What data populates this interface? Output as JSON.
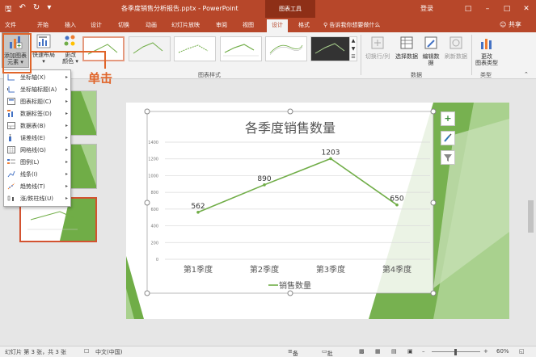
{
  "titlebar": {
    "doc_title": "各季度销售分析报告.pptx - PowerPoint",
    "context_tab": "图表工具",
    "login": "登录",
    "undo_icon": "undo-icon",
    "redo_icon": "redo-icon"
  },
  "tabs": [
    {
      "label": "文件"
    },
    {
      "label": "开始"
    },
    {
      "label": "插入"
    },
    {
      "label": "设计"
    },
    {
      "label": "切换"
    },
    {
      "label": "动画"
    },
    {
      "label": "幻灯片放映"
    },
    {
      "label": "审阅"
    },
    {
      "label": "视图"
    },
    {
      "label": "设计"
    },
    {
      "label": "格式"
    }
  ],
  "tell_me": "告诉我你想要做什么",
  "share": "共享",
  "ribbon": {
    "add_element_line1": "添加图表",
    "add_element_line2": "元素",
    "quick_layout_line1": "快速布局",
    "change_color_line1": "更改",
    "change_color_line2": "颜色",
    "chart_styles_group": "图表样式",
    "switch_row_col": "切换行/列",
    "select_data": "选择数据",
    "edit_data_line1": "编辑数",
    "edit_data_line2": "据",
    "refresh_data": "刷新数据",
    "data_group": "数据",
    "change_type_line1": "更改",
    "change_type_line2": "图表类型",
    "type_group": "类型"
  },
  "dropdown": [
    {
      "label": "坐标轴(X)"
    },
    {
      "label": "坐标轴标题(A)"
    },
    {
      "label": "图表标题(C)"
    },
    {
      "label": "数据标签(D)"
    },
    {
      "label": "数据表(B)"
    },
    {
      "label": "误差线(E)"
    },
    {
      "label": "网格线(G)"
    },
    {
      "label": "图例(L)"
    },
    {
      "label": "线条(I)"
    },
    {
      "label": "趋势线(T)"
    },
    {
      "label": "涨/跌柱线(U)"
    }
  ],
  "annotation": {
    "text": "单击"
  },
  "chart_tools": {
    "plus": "+",
    "brush_icon": "brush-icon",
    "filter_icon": "filter-icon"
  },
  "statusbar": {
    "slide_info": "幻灯片 第 3 张，共 3 张",
    "language": "中文(中国)",
    "notes": "备注",
    "comments": "批注",
    "zoom": "60%"
  },
  "chart_data": {
    "type": "line",
    "title": "各季度销售数量",
    "categories": [
      "第1季度",
      "第2季度",
      "第3季度",
      "第4季度"
    ],
    "series": [
      {
        "name": "销售数量",
        "values": [
          562,
          890,
          1203,
          650
        ],
        "color": "#70ad47"
      }
    ],
    "ylim": [
      0,
      1400
    ],
    "yticks": [
      "0",
      "200",
      "400",
      "600",
      "800",
      "1000",
      "1200",
      "1400"
    ],
    "grid": true,
    "legend_position": "bottom"
  }
}
